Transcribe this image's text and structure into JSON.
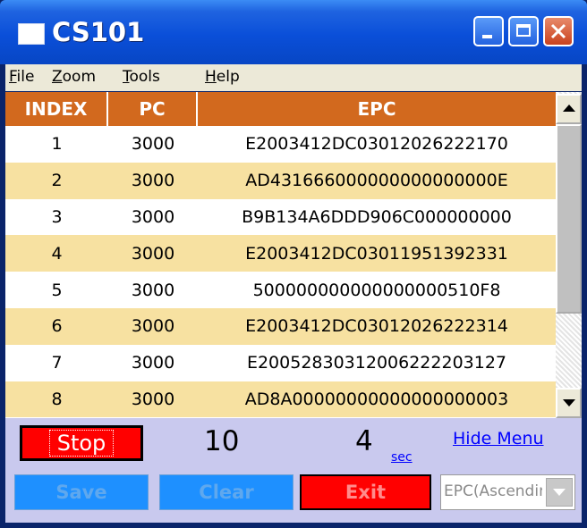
{
  "window": {
    "title": "CS101"
  },
  "menu": {
    "items": [
      {
        "label": "File"
      },
      {
        "label": "Zoom"
      },
      {
        "label": "Tools"
      },
      {
        "label": "Help"
      }
    ]
  },
  "table": {
    "headers": {
      "index": "INDEX",
      "pc": "PC",
      "epc": "EPC"
    },
    "rows": [
      {
        "index": "1",
        "pc": "3000",
        "epc": "E2003412DC03012026222170"
      },
      {
        "index": "2",
        "pc": "3000",
        "epc": "AD431666000000000000000E"
      },
      {
        "index": "3",
        "pc": "3000",
        "epc": "B9B134A6DDD906C000000000"
      },
      {
        "index": "4",
        "pc": "3000",
        "epc": "E2003412DC03011951392331"
      },
      {
        "index": "5",
        "pc": "3000",
        "epc": "500000000000000000510F8"
      },
      {
        "index": "6",
        "pc": "3000",
        "epc": "E2003412DC03012026222314"
      },
      {
        "index": "7",
        "pc": "3000",
        "epc": "E20052830312006222203127"
      },
      {
        "index": "8",
        "pc": "3000",
        "epc": "AD8A00000000000000000003"
      }
    ],
    "colors": {
      "header": "#d2691e",
      "alt_row": "#f7e1a1"
    }
  },
  "controls": {
    "stop_label": "Stop",
    "tag_count": "10",
    "elapsed": "4",
    "elapsed_unit": "sec",
    "hide_menu_label": "Hide Menu",
    "save_label": "Save",
    "clear_label": "Clear",
    "exit_label": "Exit",
    "sort_value": "EPC(Ascending)"
  }
}
